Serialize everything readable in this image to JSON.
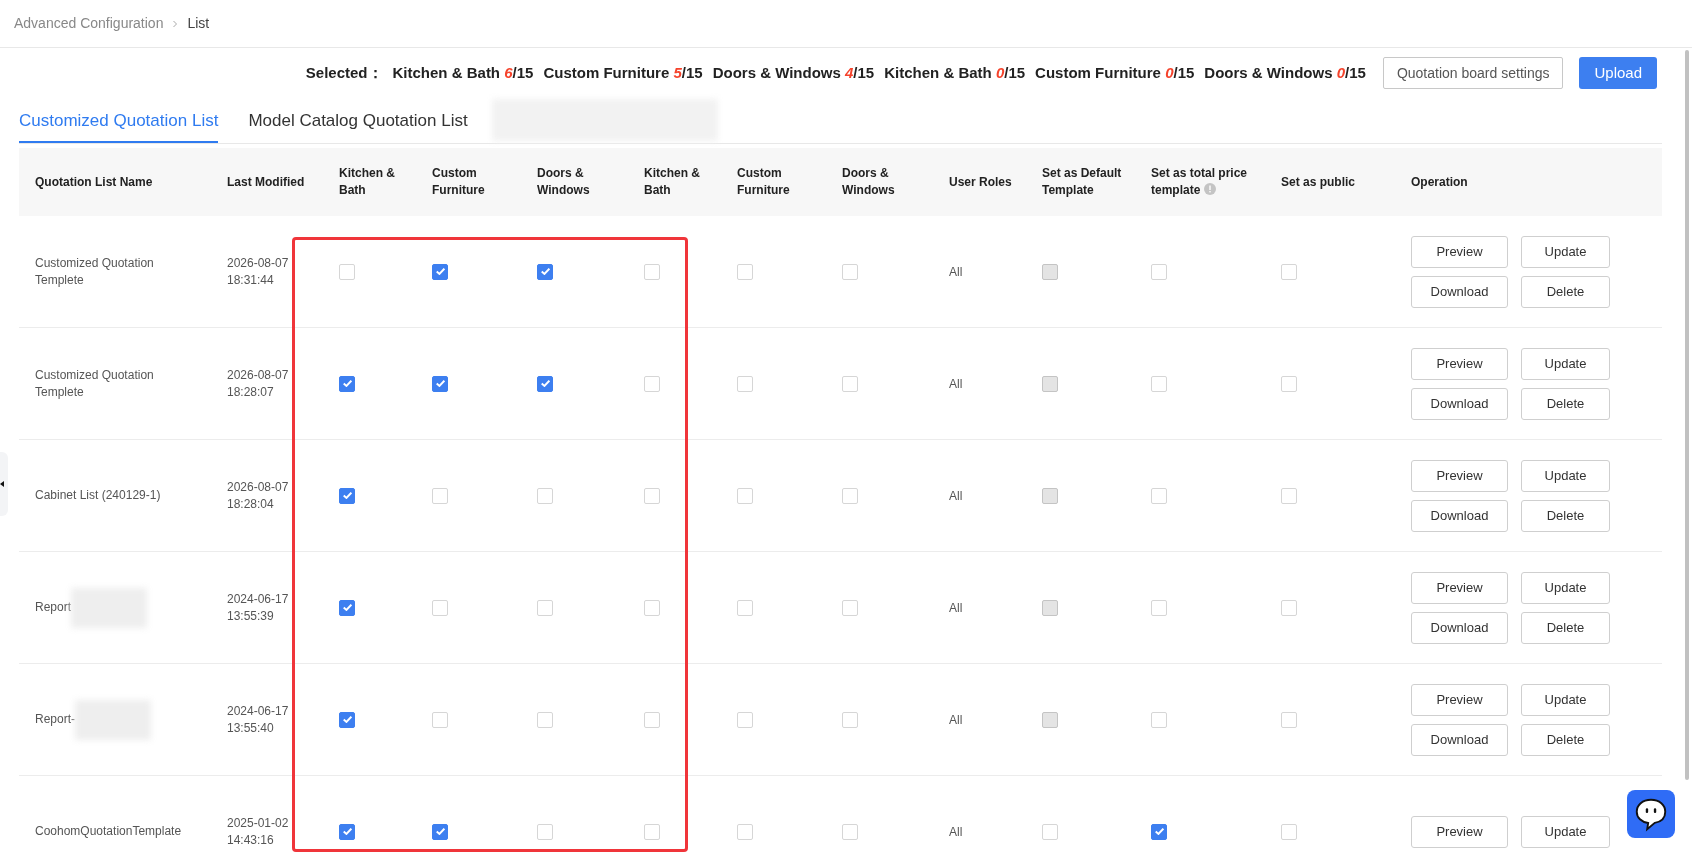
{
  "breadcrumb": [
    "Advanced Configuration",
    "List"
  ],
  "summary": {
    "label": "Selected：",
    "items": [
      {
        "name": "Kitchen & Bath",
        "count": "6",
        "total": "/15"
      },
      {
        "name": "Custom Furniture",
        "count": "5",
        "total": "/15"
      },
      {
        "name": "Doors & Windows",
        "count": "4",
        "total": "/15"
      },
      {
        "name": "Kitchen & Bath",
        "count": "0",
        "total": "/15"
      },
      {
        "name": "Custom Furniture",
        "count": "0",
        "total": "/15"
      },
      {
        "name": "Doors & Windows",
        "count": "0",
        "total": "/15"
      }
    ]
  },
  "actions": [
    {
      "label": "Quotation board settings",
      "kind": "outline"
    },
    {
      "label": "Upload",
      "kind": "primary"
    }
  ],
  "tabs": [
    {
      "label": "Customized Quotation List",
      "selected": true
    },
    {
      "label": "Model Catalog Quotation List",
      "selected": false
    }
  ],
  "tabs_redacted": true,
  "table": {
    "columns": [
      {
        "label": "Quotation List Name"
      },
      {
        "label": "Last Modified"
      },
      {
        "label": "Kitchen & Bath"
      },
      {
        "label": "Custom Furniture"
      },
      {
        "label": "Doors & Windows"
      },
      {
        "label": "Kitchen & Bath"
      },
      {
        "label": "Custom Furniture"
      },
      {
        "label": "Doors & Windows"
      },
      {
        "label": "User Roles"
      },
      {
        "label": "Set as Default Template"
      },
      {
        "label": "Set as total price template",
        "info": true
      },
      {
        "label": "Set as public"
      },
      {
        "label": "Operation"
      }
    ],
    "rows": [
      {
        "name": "Customized Quotation Templete",
        "redacted": false,
        "date": "2026-08-07",
        "time": "18:31:44",
        "checks": [
          false,
          true,
          true,
          false,
          false,
          false
        ],
        "roles": "All",
        "default": {
          "checked": false,
          "disabled": true
        },
        "total_price": false,
        "public": false,
        "buttons": [
          "Preview",
          "Update",
          "Download",
          "Delete"
        ]
      },
      {
        "name": "Customized Quotation Templete",
        "redacted": false,
        "date": "2026-08-07",
        "time": "18:28:07",
        "checks": [
          true,
          true,
          true,
          false,
          false,
          false
        ],
        "roles": "All",
        "default": {
          "checked": false,
          "disabled": true
        },
        "total_price": false,
        "public": false,
        "buttons": [
          "Preview",
          "Update",
          "Download",
          "Delete"
        ]
      },
      {
        "name": "Cabinet List (240129-1)",
        "redacted": false,
        "date": "2026-08-07",
        "time": "18:28:04",
        "checks": [
          true,
          false,
          false,
          false,
          false,
          false
        ],
        "roles": "All",
        "default": {
          "checked": false,
          "disabled": true
        },
        "total_price": false,
        "public": false,
        "buttons": [
          "Preview",
          "Update",
          "Download",
          "Delete"
        ]
      },
      {
        "name": "Report",
        "redacted": true,
        "date": "2024-06-17",
        "time": "13:55:39",
        "checks": [
          true,
          false,
          false,
          false,
          false,
          false
        ],
        "roles": "All",
        "default": {
          "checked": false,
          "disabled": true
        },
        "total_price": false,
        "public": false,
        "buttons": [
          "Preview",
          "Update",
          "Download",
          "Delete"
        ]
      },
      {
        "name": "Report-",
        "redacted": true,
        "date": "2024-06-17",
        "time": "13:55:40",
        "checks": [
          true,
          false,
          false,
          false,
          false,
          false
        ],
        "roles": "All",
        "default": {
          "checked": false,
          "disabled": true
        },
        "total_price": false,
        "public": false,
        "buttons": [
          "Preview",
          "Update",
          "Download",
          "Delete"
        ]
      },
      {
        "name": "CoohomQuotationTemplate",
        "redacted": false,
        "date": "2025-01-02",
        "time": "14:43:16",
        "checks": [
          true,
          true,
          false,
          false,
          false,
          false
        ],
        "roles": "All",
        "default": {
          "checked": false,
          "disabled": false
        },
        "total_price": true,
        "public": false,
        "buttons": [
          "Preview",
          "Update"
        ]
      }
    ]
  }
}
